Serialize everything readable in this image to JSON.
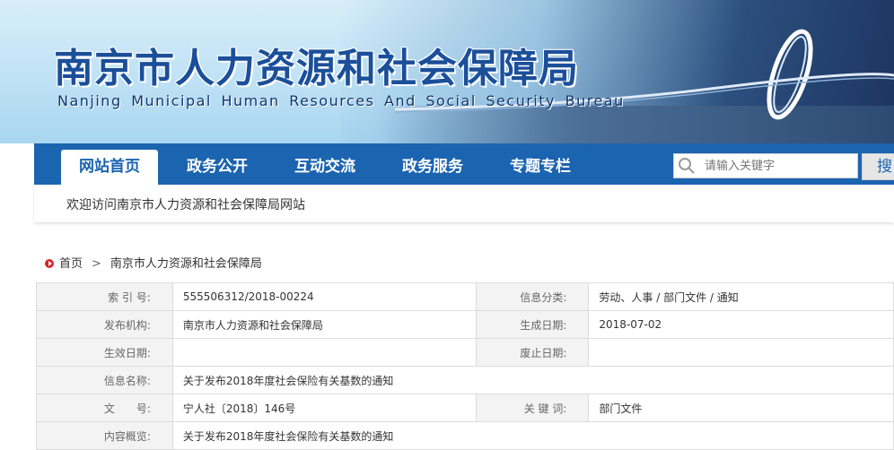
{
  "banner": {
    "title_cn": "南京市人力资源和社会保障局",
    "title_en": "Nanjing Municipal Human Resources And Social Security Bureau"
  },
  "nav": {
    "tabs": [
      {
        "label": "网站首页",
        "active": true
      },
      {
        "label": "政务公开",
        "active": false
      },
      {
        "label": "互动交流",
        "active": false
      },
      {
        "label": "政务服务",
        "active": false
      },
      {
        "label": "专题专栏",
        "active": false
      }
    ],
    "search_placeholder": "请输入关键字",
    "search_button": "搜索"
  },
  "welcome": "欢迎访问南京市人力资源和社会保障局网站",
  "breadcrumb": {
    "home": "首页",
    "separator": ">",
    "current": "南京市人力资源和社会保障局"
  },
  "info_table": [
    {
      "l1": "索 引 号:",
      "v1": "555506312/2018-00224",
      "l2": "信息分类:",
      "v2": "劳动、人事 / 部门文件 / 通知"
    },
    {
      "l1": "发布机构:",
      "v1": "南京市人力资源和社会保障局",
      "l2": "生成日期:",
      "v2": "2018-07-02"
    },
    {
      "l1": "生效日期:",
      "v1": "",
      "l2": "废止日期:",
      "v2": ""
    },
    {
      "l1": "信息名称:",
      "v1": "关于发布2018年度社会保险有关基数的通知"
    },
    {
      "l1": "文　　号:",
      "v1": "宁人社〔2018〕146号",
      "l2": "关 键 词:",
      "v2": "部门文件"
    },
    {
      "l1": "内容概览:",
      "v1": "关于发布2018年度社会保险有关基数的通知"
    }
  ],
  "colors": {
    "nav_blue": "#1b64b0",
    "title_blue": "#1b4f9a",
    "home_icon_red": "#d8262e"
  }
}
